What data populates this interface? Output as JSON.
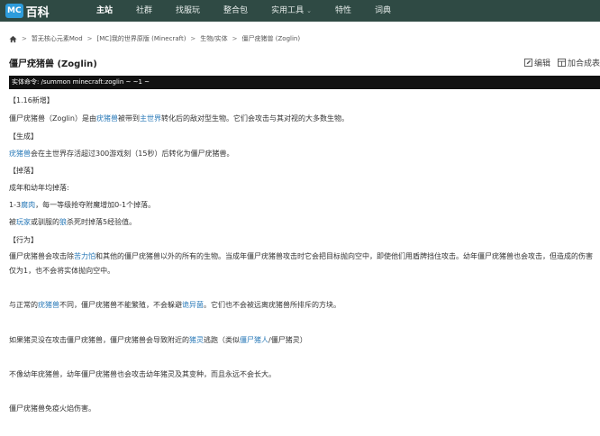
{
  "nav": {
    "logo_badge": "MC",
    "logo_text": "百科",
    "items": [
      {
        "label": "主站",
        "active": true
      },
      {
        "label": "社群"
      },
      {
        "label": "找服玩"
      },
      {
        "label": "整合包"
      },
      {
        "label": "实用工具",
        "dropdown": true
      },
      {
        "label": "特性"
      },
      {
        "label": "词典"
      }
    ]
  },
  "breadcrumb": {
    "items": [
      "暂无核心元素Mod",
      "[MC]我的世界原版 (Minecraft)",
      "生物/实体",
      "僵尸疣猪兽 (Zoglin)"
    ],
    "sep": ">"
  },
  "page": {
    "title": "僵尸疣猪兽 (Zoglin)",
    "edit_label": "编辑",
    "compare_label": "加合成表"
  },
  "command": "实体命令: /summon minecraft:zoglin ~ ~1 ~",
  "content": {
    "h_new": "【1.16新增】",
    "intro_a": "僵尸疣猪兽（Zoglin）是由",
    "intro_link1": "疣猪兽",
    "intro_b": "被带到",
    "intro_link2": "主世界",
    "intro_c": "转化后的敌对型生物。它们会攻击与其对视的大多数生物。",
    "h_spawn": "【生成】",
    "spawn_link": "疣猪兽",
    "spawn_text": "会在主世界存活超过300游戏刻（15秒）后转化为僵尸疣猪兽。",
    "h_drop": "【掉落】",
    "drop1": "成年和幼年均掉落:",
    "drop2_a": "1-3",
    "drop2_link": "腐肉",
    "drop2_b": "，每一等级抢夺附魔增加0-1个掉落。",
    "drop3_a": "被",
    "drop3_link1": "玩家",
    "drop3_b": "或驯服的",
    "drop3_link2": "狼",
    "drop3_c": "杀死时掉落5经验值。",
    "h_behavior": "【行为】",
    "beh1_a": "僵尸疣猪兽会攻击除",
    "beh1_link": "苦力怕",
    "beh1_b": "和其他的僵尸疣猪兽以外的所有的生物。当成年僵尸疣猪兽攻击时它会把目标抛向空中，即使他们用盾牌挡住攻击。幼年僵尸疣猪兽也会攻击，但造成的伤害仅为1，也不会将实体抛向空中。",
    "beh2_a": "与正常的",
    "beh2_link1": "疣猪兽",
    "beh2_b": "不同，僵尸疣猪兽不能繁殖，不会躲避",
    "beh2_link2": "诡异菌",
    "beh2_c": "。它们也不会被远离疣猪兽所排斥的方块。",
    "beh3_a": "如果猪灵没在攻击僵尸疣猪兽，僵尸疣猪兽会导致附近的",
    "beh3_link1": "猪灵",
    "beh3_b": "逃跑（类似",
    "beh3_link2": "僵尸猪人",
    "beh3_c": "/僵尸猪灵）",
    "beh4": "不像幼年疣猪兽，幼年僵尸疣猪兽也会攻击幼年猪灵及其变种，而且永远不会长大。",
    "beh5": "僵尸疣猪兽免疫火焰伤害。"
  }
}
